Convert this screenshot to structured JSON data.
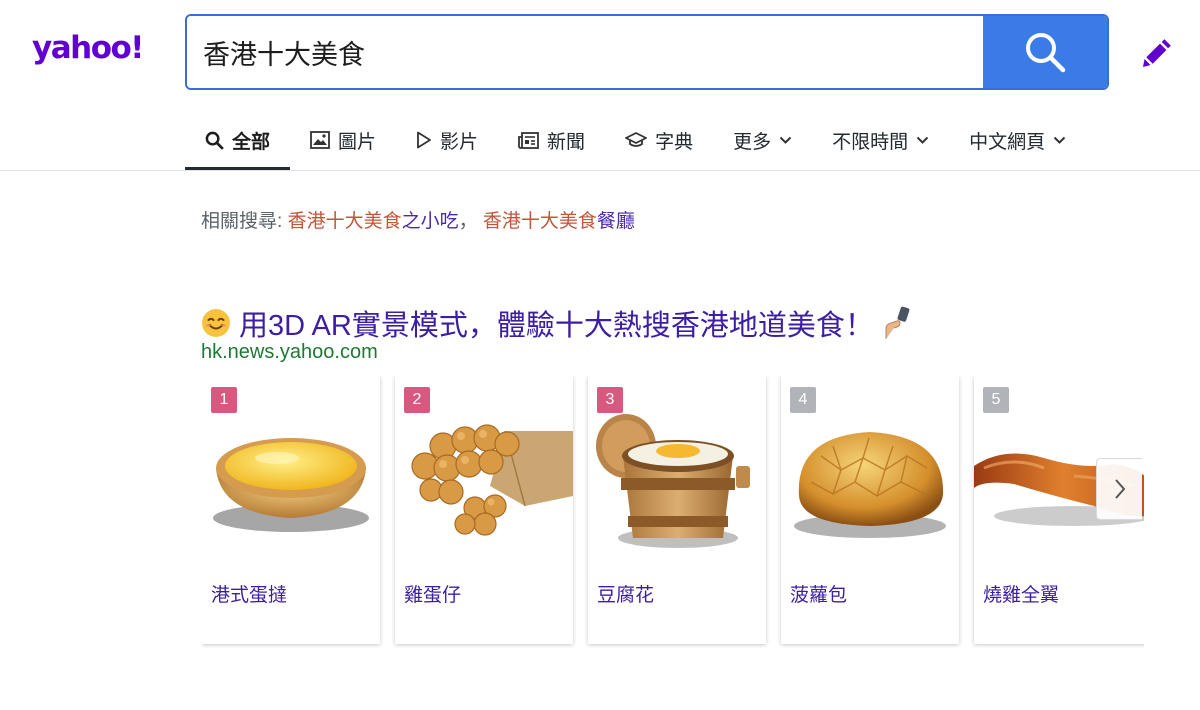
{
  "logo": "yahoo!",
  "search": {
    "query": "香港十大美食"
  },
  "tabs": [
    {
      "label": "全部",
      "icon": "search-icon",
      "active": true
    },
    {
      "label": "圖片",
      "icon": "image-icon"
    },
    {
      "label": "影片",
      "icon": "play-icon"
    },
    {
      "label": "新聞",
      "icon": "news-icon"
    },
    {
      "label": "字典",
      "icon": "dictionary-icon"
    },
    {
      "label": "更多",
      "icon": "chevron-down-icon"
    },
    {
      "label": "不限時間",
      "icon": "chevron-down-icon"
    },
    {
      "label": "中文網頁",
      "icon": "chevron-down-icon"
    }
  ],
  "related": {
    "prefix": "相關搜尋:",
    "items": [
      {
        "highlight": "香港十大美食",
        "rest": "之小吃",
        "sep": "，"
      },
      {
        "highlight": "香港十大美食",
        "rest": "餐廳",
        "sep": ""
      }
    ]
  },
  "result": {
    "title": "用3D AR實景模式，體驗十大熱搜香港地道美食！",
    "url": "hk.news.yahoo.com"
  },
  "carousel": {
    "items": [
      {
        "rank": "1",
        "label": "港式蛋撻",
        "badge_color": "#d9587f"
      },
      {
        "rank": "2",
        "label": "雞蛋仔",
        "badge_color": "#d9587f"
      },
      {
        "rank": "3",
        "label": "豆腐花",
        "badge_color": "#d9587f"
      },
      {
        "rank": "4",
        "label": "菠蘿包",
        "badge_color": "#b0b3b8"
      },
      {
        "rank": "5",
        "label": "燒雞全翼",
        "badge_color": "#b0b3b8"
      }
    ]
  },
  "colors": {
    "brand": "#6001d2",
    "search_button": "#3a7be8",
    "link": "#3d1ea3",
    "url": "#1d7a33",
    "highlight": "#c2563a"
  }
}
